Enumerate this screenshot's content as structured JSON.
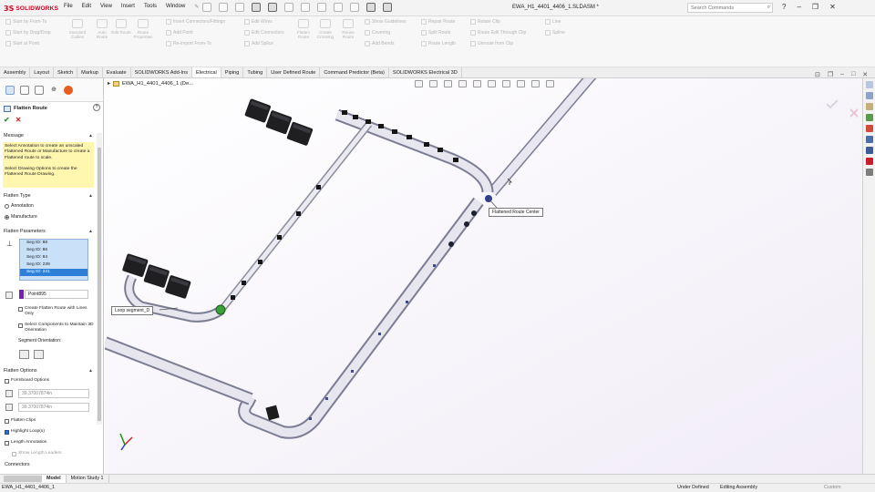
{
  "app": {
    "logo_text": "SOLIDWORKS",
    "document_title": "EWA_H1_4401_4406_1.SLDASM *",
    "search_placeholder": "Search Commands",
    "menu": [
      "File",
      "Edit",
      "View",
      "Insert",
      "Tools",
      "Window"
    ]
  },
  "commands": {
    "left_small": [
      "Start by From-To",
      "Start by Drag/Drop",
      "Start at Point"
    ],
    "left_big": [
      {
        "label": "Standard Cables"
      },
      {
        "label": "Auto Route"
      },
      {
        "label": "Edit Route"
      },
      {
        "label": "Route Properties"
      }
    ],
    "mid_small_1": [
      "Insert Connectors/Fittings",
      "Add Point",
      "Re-import From-To"
    ],
    "mid_small_2": [
      "Edit Wires",
      "Edit Connectors",
      "Add Splice"
    ],
    "mid_big": [
      {
        "label": "Flatten Route"
      },
      {
        "label": "Create Crossing"
      },
      {
        "label": "Reuse Route"
      }
    ],
    "right_small_1": [
      "Show Guidelines",
      "Covering",
      "Add Bends"
    ],
    "right_small_2": [
      "Repair Route",
      "Split Route",
      "Route Length"
    ],
    "right_small_3": [
      "Rotate Clip",
      "Route Edit Through Clip",
      "Unroute from Clip"
    ],
    "right_small_4": [
      "Line",
      "Spline"
    ]
  },
  "tabs": [
    {
      "label": "Assembly",
      "active": false
    },
    {
      "label": "Layout",
      "active": false
    },
    {
      "label": "Sketch",
      "active": false
    },
    {
      "label": "Markup",
      "active": false
    },
    {
      "label": "Evaluate",
      "active": false
    },
    {
      "label": "SOLIDWORKS Add-Ins",
      "active": false
    },
    {
      "label": "Electrical",
      "active": true
    },
    {
      "label": "Piping",
      "active": false
    },
    {
      "label": "Tubing",
      "active": false
    },
    {
      "label": "User Defined Route",
      "active": false
    },
    {
      "label": "Command Predictor (Beta)",
      "active": false
    },
    {
      "label": "SOLIDWORKS Electrical 3D",
      "active": false
    }
  ],
  "panel": {
    "title": "Flatten Route",
    "help": "?",
    "message_header": "Message",
    "message_text": "Select Annotation to create an unscaled Flattened Route or Manufacture to create a Flattened route to scale.\n\nSelect Drawing Options to create the Flattened Route Drawing.",
    "flatten_type_header": "Flatten Type",
    "flatten_type_options": [
      {
        "label": "Annotation",
        "selected": false
      },
      {
        "label": "Manufacture",
        "selected": true
      }
    ],
    "flatten_params_header": "Flatten Parameters",
    "segments": [
      "Seg ID: 88",
      "Seg ID: 86",
      "Seg ID: 84",
      "Seg ID: 239",
      "Seg ID: 241"
    ],
    "selected_segment_index": 4,
    "point_value": "Point895",
    "create_lines_only": "Create Flatten Route with Lines Only",
    "maintain_3d": "Select Components to Maintain 3D Orientation",
    "segment_orientation": "Segment Orientation:",
    "flatten_options_header": "Flatten Options",
    "formboard_options": "Formboard Options",
    "dim1": "39.37007874in",
    "dim2": "39.37007874in",
    "flatten_clips": "Flatten Clips",
    "highlight_loops": "Highlight Loop(s)",
    "length_annotation": "Length Annotation",
    "show_length_leaders": "Show Length Leaders",
    "connectors": "Connectors"
  },
  "viewport": {
    "breadcrumb": "EWA_H1_4401_4406_1 (De...",
    "callout_center": "Flattened Route Center",
    "callout_loop": "Loop segment_D"
  },
  "bottom_tabs": [
    {
      "label": "Model",
      "active": true
    },
    {
      "label": "Motion Study 1",
      "active": false
    }
  ],
  "status": {
    "file": "EWA_H1_4401_4406_1",
    "state": "Under Defined",
    "mode": "Editing Assembly",
    "units": "Custom"
  }
}
